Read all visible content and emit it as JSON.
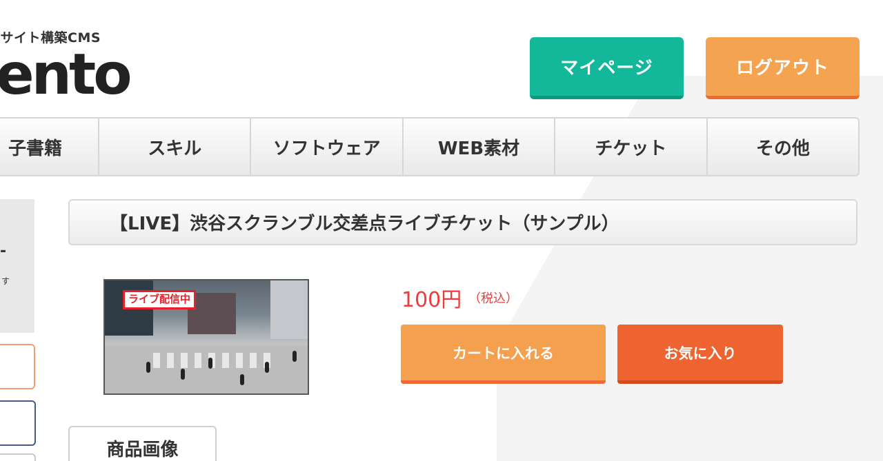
{
  "header": {
    "tagline": "゙サイト構築CMS",
    "logo_text": "ento"
  },
  "header_buttons": {
    "mypage": "マイページ",
    "logout": "ログアウト"
  },
  "nav": {
    "items": [
      "子書籍",
      "スキル",
      "ソフトウェア",
      "WEB素材",
      "チケット",
      "その他"
    ]
  },
  "sidebar": {
    "text1": "-",
    "text2": "す"
  },
  "product": {
    "title": "【LIVE】渋谷スクランブル交差点ライブチケット（サンプル）",
    "badge": "ライブ配信中",
    "price": "100円",
    "tax_note": "（税込）",
    "cart_label": "カートに入れる",
    "favorite_label": "お気に入り",
    "images_tab": "商品画像"
  },
  "colors": {
    "teal": "#13b89b",
    "orange": "#f4a450",
    "red_orange": "#ee6430",
    "price_red": "#ee3b3b"
  }
}
